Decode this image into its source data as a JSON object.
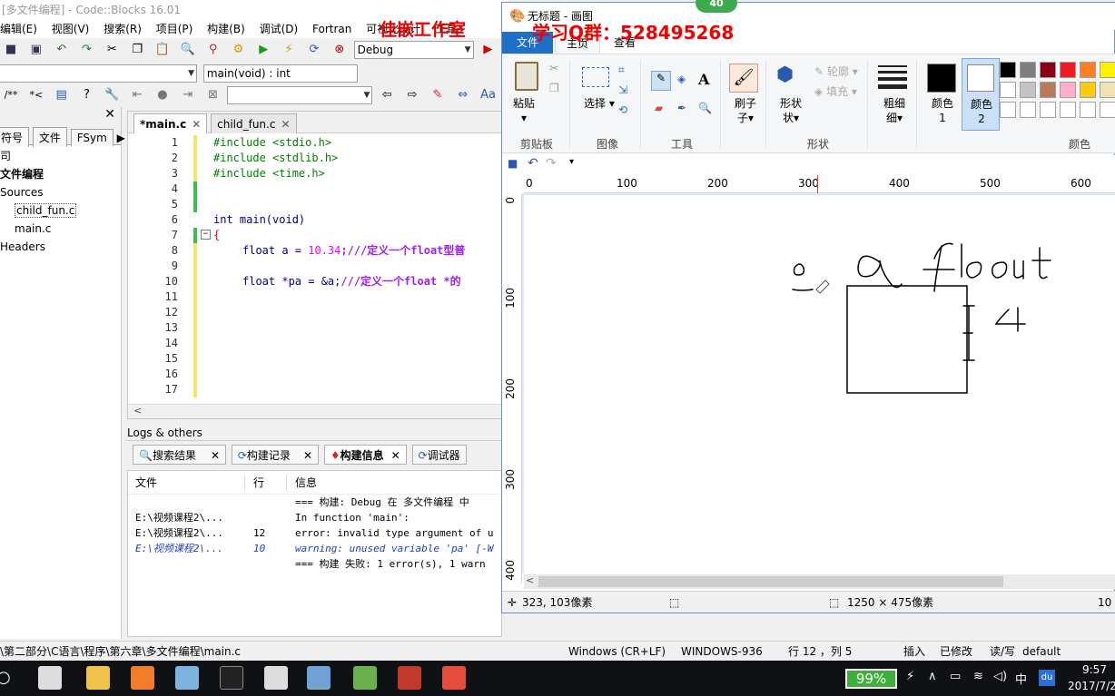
{
  "codeblocks": {
    "title": "[多文件编程] - Code::Blocks 16.01",
    "menu": [
      "编辑(E)",
      "视图(V)",
      "搜索(R)",
      "项目(P)",
      "构建(B)",
      "调试(D)",
      "Fortran",
      "可视化设计",
      "工具+"
    ],
    "build_target": "Debug",
    "function_combo": "main(void) : int",
    "management": {
      "tabs": [
        "符号",
        "文件",
        "FSym"
      ],
      "tree": [
        "司",
        "文件编程",
        "Sources",
        "child_fun.c",
        "main.c",
        "Headers"
      ]
    },
    "editor": {
      "tabs": [
        {
          "label": "*main.c",
          "active": true
        },
        {
          "label": "child_fun.c",
          "active": false
        }
      ],
      "lines": [
        {
          "no": "1",
          "text": "#include <stdio.h>"
        },
        {
          "no": "2",
          "text": "#include <stdlib.h>"
        },
        {
          "no": "3",
          "text": "#include <time.h>"
        },
        {
          "no": "4",
          "text": ""
        },
        {
          "no": "5",
          "text": ""
        },
        {
          "no": "6",
          "text": "int main(void)"
        },
        {
          "no": "7",
          "text": "{"
        },
        {
          "no": "8",
          "code": "float a = ",
          "num": "10.34",
          "comment": ";///定义一个float型普"
        },
        {
          "no": "9",
          "text": ""
        },
        {
          "no": "10",
          "code": "float *pa = &a;",
          "comment": "///定义一个float *的"
        },
        {
          "no": "11",
          "text": ""
        },
        {
          "no": "12",
          "text": ""
        },
        {
          "no": "13",
          "text": ""
        },
        {
          "no": "14",
          "text": ""
        },
        {
          "no": "15",
          "text": ""
        },
        {
          "no": "16",
          "text": ""
        },
        {
          "no": "17",
          "text": ""
        }
      ]
    },
    "logs": {
      "title": "Logs & others",
      "tabs": [
        "搜索结果",
        "构建记录",
        "构建信息",
        "调试器"
      ],
      "columns": [
        "文件",
        "行",
        "信息"
      ],
      "rows": [
        {
          "file": "",
          "line": "",
          "msg": "=== 构建: Debug 在 多文件编程 中"
        },
        {
          "file": "E:\\视频课程2\\...",
          "line": "",
          "msg": "In function 'main':"
        },
        {
          "file": "E:\\视频课程2\\...",
          "line": "12",
          "msg": "error: invalid type argument of u"
        },
        {
          "file": "E:\\视频课程2\\...",
          "line": "10",
          "msg": "warning: unused variable 'pa' [-W"
        },
        {
          "file": "",
          "line": "",
          "msg": "=== 构建 失败: 1 error(s), 1 warn"
        }
      ]
    },
    "status": {
      "path": "\\第二部分\\C语言\\程序\\第六章\\多文件编程\\main.c",
      "eol": "Windows (CR+LF)",
      "encoding": "WINDOWS-936",
      "position": "行 12 ，列 5",
      "mode": "插入",
      "modified": "已修改",
      "rw": "读/写",
      "profile": "default"
    }
  },
  "paint": {
    "title": "无标题 - 画图",
    "tabs": [
      "文件",
      "主页",
      "查看"
    ],
    "ribbon": {
      "paste": "粘贴",
      "select": "选择",
      "brush": "刷子",
      "shapes": "形状",
      "outline": "轮廓",
      "fill": "填充",
      "size": "粗细",
      "color1": "颜色 1",
      "color2": "颜色 2",
      "groups": [
        "剪贴板",
        "图像",
        "工具",
        "形状",
        "颜色"
      ]
    },
    "palette": [
      "#000000",
      "#7f7f7f",
      "#880015",
      "#ed1c24",
      "#ff7f27",
      "#fff200",
      "#ffffff",
      "#c3c3c3",
      "#b97a57",
      "#ffaec9",
      "#ffc90e",
      "#efe4b0"
    ],
    "ruler_top": [
      "0",
      "100",
      "200",
      "300",
      "400",
      "500",
      "600"
    ],
    "ruler_left": [
      "0",
      "100",
      "200",
      "300",
      "400"
    ],
    "status_cursor": "323, 103像素",
    "status_size": "1250 × 475像素",
    "status_zoom": "10"
  },
  "watermark": {
    "studio": "佳嵌工作室",
    "qq": "学习Q群：528495268",
    "badge": "40"
  },
  "taskbar": {
    "battery": "99%",
    "ime": "中",
    "time": "9:57",
    "date": "2017/7/2"
  }
}
